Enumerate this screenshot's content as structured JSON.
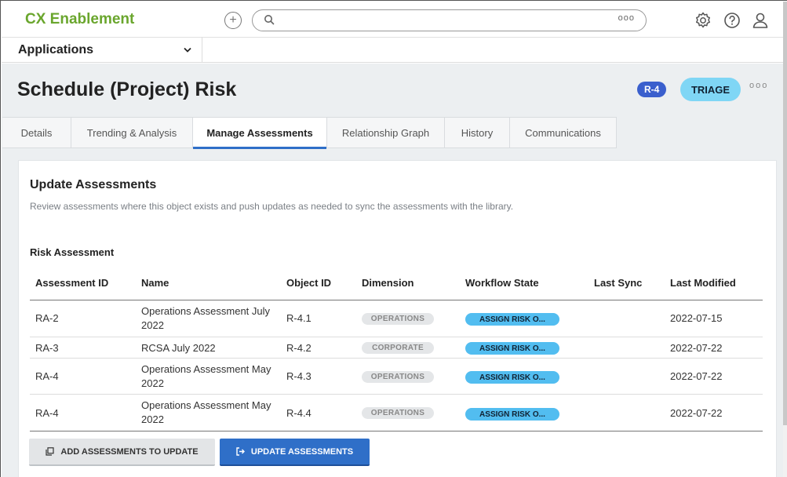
{
  "header": {
    "brand": "CX Enablement",
    "search": {
      "placeholder": "",
      "more": "ooo"
    }
  },
  "appbar": {
    "selected": "Applications"
  },
  "record": {
    "title": "Schedule (Project) Risk",
    "id_badge": "R-4",
    "state_badge": "TRIAGE",
    "more": "ooo"
  },
  "tabs": [
    {
      "label": "Details"
    },
    {
      "label": "Trending & Analysis"
    },
    {
      "label": "Manage Assessments"
    },
    {
      "label": "Relationship Graph"
    },
    {
      "label": "History"
    },
    {
      "label": "Communications"
    }
  ],
  "card": {
    "title": "Update Assessments",
    "description": "Review assessments where this object exists and push updates as needed to sync the assessments with the library.",
    "section_label": "Risk Assessment",
    "columns": [
      "Assessment ID",
      "Name",
      "Object ID",
      "Dimension",
      "Workflow State",
      "Last Sync",
      "Last Modified"
    ],
    "rows": [
      {
        "assessment_id": "RA-2",
        "name_line1": "Operations Assessment July",
        "name_line2": "2022",
        "object_id": "R-4.1",
        "dimension": "OPERATIONS",
        "workflow_state": "ASSIGN RISK O...",
        "last_sync": "",
        "last_modified": "2022-07-15"
      },
      {
        "assessment_id": "RA-3",
        "name_line1": "RCSA July 2022",
        "name_line2": "",
        "object_id": "R-4.2",
        "dimension": "CORPORATE",
        "workflow_state": "ASSIGN RISK O...",
        "last_sync": "",
        "last_modified": "2022-07-22"
      },
      {
        "assessment_id": "RA-4",
        "name_line1": "Operations Assessment May",
        "name_line2": "2022",
        "object_id": "R-4.3",
        "dimension": "OPERATIONS",
        "workflow_state": "ASSIGN RISK O...",
        "last_sync": "",
        "last_modified": "2022-07-22"
      },
      {
        "assessment_id": "RA-4",
        "name_line1": "Operations Assessment May",
        "name_line2": "2022",
        "object_id": "R-4.4",
        "dimension": "OPERATIONS",
        "workflow_state": "ASSIGN RISK O...",
        "last_sync": "",
        "last_modified": "2022-07-22"
      }
    ],
    "buttons": {
      "add_label": "ADD ASSESSMENTS TO UPDATE",
      "update_label": "UPDATE ASSESSMENTS"
    }
  },
  "colors": {
    "brand": "#6aa62d",
    "primary": "#2f6fc8",
    "id_badge": "#3a5fcd",
    "state_badge": "#7fd6f5",
    "workflow_pill": "#52bdf0"
  },
  "icons": [
    "add-circle-icon",
    "search-icon",
    "settings-gear-icon",
    "help-icon",
    "user-icon",
    "chevron-down-icon",
    "copy-icon",
    "export-icon"
  ]
}
